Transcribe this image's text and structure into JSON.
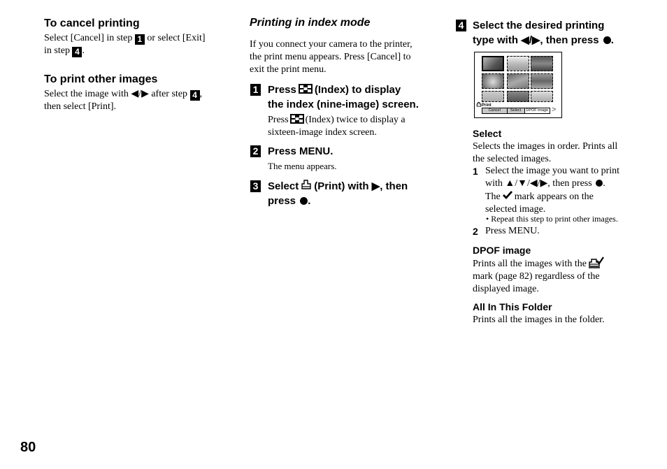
{
  "page_number": "80",
  "left_column": {
    "cancel": {
      "heading": "To cancel printing",
      "text_a": "Select [Cancel] in step ",
      "step_a": "1",
      "text_b": " or select [Exit]",
      "text_c": "in step ",
      "step_b": "4",
      "text_d": "."
    },
    "other": {
      "heading": "To print other images",
      "text_a": "Select the image with ◀/▶ after step ",
      "step": "4",
      "text_b": ",",
      "text_c": "then select [Print]."
    }
  },
  "middle_column": {
    "heading": "Printing in index mode",
    "intro_lines": [
      "If you connect your camera to the printer,",
      "the print menu appears. Press [Cancel] to",
      "exit the print menu."
    ],
    "step1": {
      "num": "1",
      "line1_a": "Press",
      "line1_b": "(Index) to display",
      "line2": "the index (nine-image) screen.",
      "note_a": "Press",
      "note_b": "(Index) twice to display a",
      "note_c": "sixteen-image index screen."
    },
    "step2": {
      "num": "2",
      "title": "Press MENU.",
      "note": "The menu appears."
    },
    "step3": {
      "num": "3",
      "line1_a": "Select",
      "line1_b": "(Print) with ▶, then",
      "line2": "press"
    }
  },
  "right_column": {
    "step4": {
      "num": "4",
      "line1": "Select the desired printing",
      "line2": "type with ◀/▶, then press"
    },
    "lcd": {
      "menu_title": "Print",
      "buttons": [
        "Cancel",
        "Select",
        "DPOF image"
      ],
      "next_arrow": ">",
      "thumb_count": 9,
      "selected_thumb": 0
    },
    "select": {
      "heading": "Select",
      "desc_lines": [
        "Selects the images in order. Prints all",
        "the selected images."
      ],
      "item1_num": "1",
      "item1_line1": "Select the image you want to print",
      "item1_line2": "with ▲/▼/◀/▶, then press",
      "item1_line3_a": "The",
      "item1_line3_b": "mark appears on the",
      "item1_line4": "selected image.",
      "bullet": "Repeat this step to print other images.",
      "item2_num": "2",
      "item2_text": "Press MENU."
    },
    "dpof": {
      "heading": "DPOF image",
      "line1": "Prints all the images with the",
      "line2": "mark (page 82) regardless of the",
      "line3": "displayed image."
    },
    "folder": {
      "heading": "All In This Folder",
      "line1": "Prints all the images in the folder."
    }
  }
}
